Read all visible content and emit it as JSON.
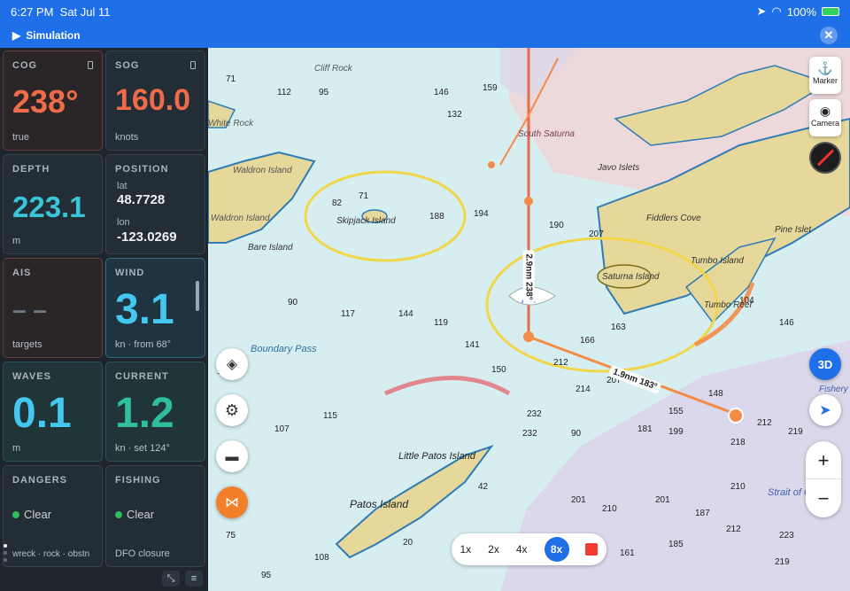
{
  "status": {
    "time": "6:27 PM",
    "date": "Sat Jul 11",
    "battery": "100%"
  },
  "sim": {
    "label": "Simulation"
  },
  "tiles": {
    "cog": {
      "title": "COG",
      "value": "238°",
      "unit": "true"
    },
    "sog": {
      "title": "SOG",
      "value": "160.0",
      "unit": "knots"
    },
    "depth": {
      "title": "DEPTH",
      "value": "223.1",
      "unit": "m"
    },
    "position": {
      "title": "POSITION",
      "lat_label": "lat",
      "lat": "48.7728",
      "lon_label": "lon",
      "lon": "-123.0269"
    },
    "ais": {
      "title": "AIS",
      "value": "– –",
      "unit": "targets"
    },
    "wind": {
      "title": "WIND",
      "value": "3.1",
      "unit": "kn · from 68°"
    },
    "waves": {
      "title": "WAVES",
      "value": "0.1",
      "unit": "m"
    },
    "current": {
      "title": "CURRENT",
      "value": "1.2",
      "unit": "kn · set 124°"
    },
    "dangers": {
      "title": "DANGERS",
      "status": "Clear",
      "unit": "wreck · rock · obstn"
    },
    "fishing": {
      "title": "FISHING",
      "status": "Clear",
      "unit": "DFO closure"
    }
  },
  "colors": {
    "accent": "#1f70e8",
    "cog": "#ef6b4a",
    "sog": "#ef6b4a",
    "depth": "#38c6d8",
    "wind": "#45c8f0",
    "waves": "#45c8f0",
    "current": "#2fbf9f",
    "land": "#e6d79a",
    "clear": "#2fbf5a"
  },
  "map": {
    "labels": [
      "Skipjack Island",
      "Waldron Island",
      "Bare Island",
      "Saturna Island",
      "Tumbo Island",
      "Tumbo Reef",
      "Pine Islet",
      "Fiddlers Cove",
      "Javo Islets",
      "South Saturna",
      "Boundary Pass",
      "Little Patos Island",
      "Patos Island",
      "Strait of Georgia",
      "Fishery",
      "Waldron Island",
      "Cliff Rock",
      "White Rock"
    ],
    "vectors": {
      "a": "2.9nm 238°",
      "b": "1.9nm 183°"
    }
  },
  "buttons": {
    "marker": "Marker",
    "camera": "Camera",
    "three_d": "3D",
    "zoom_in": "+",
    "zoom_out": "−"
  },
  "zoom": {
    "options": [
      "1x",
      "2x",
      "4x",
      "8x"
    ],
    "selected": "8x"
  }
}
